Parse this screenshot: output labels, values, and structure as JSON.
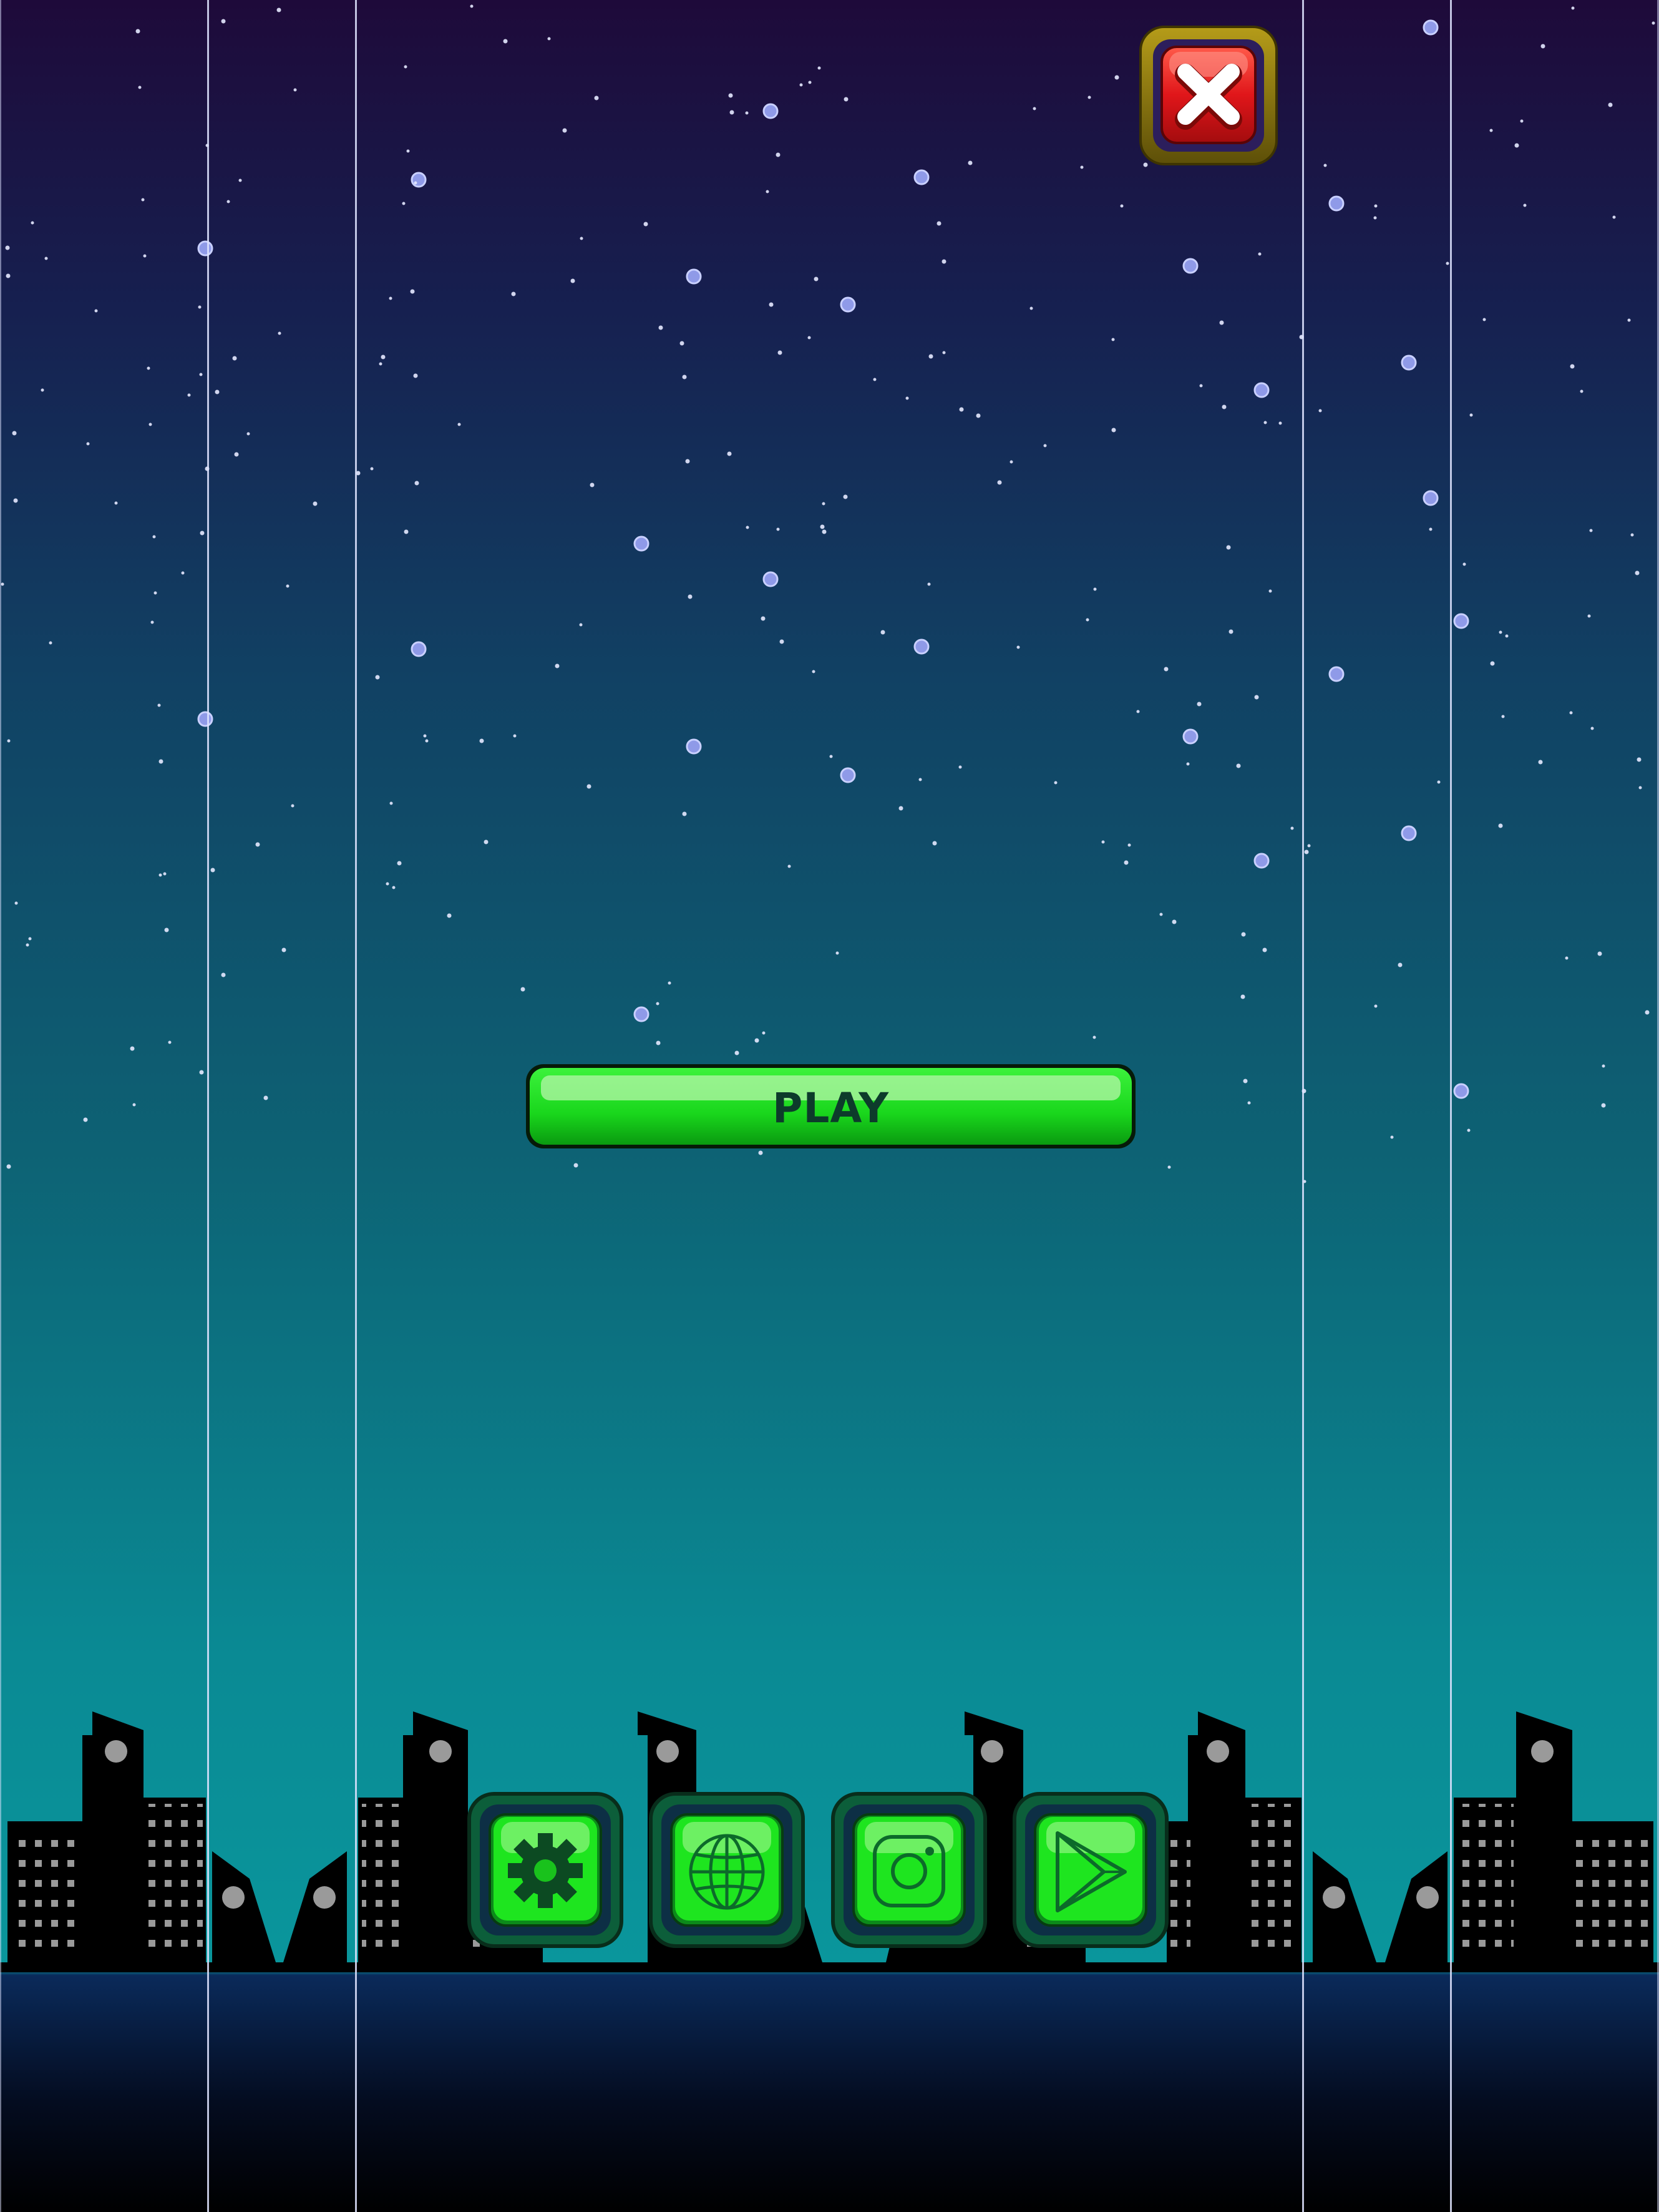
{
  "screen": {
    "name": "main-menu",
    "colors": {
      "sky_top": "#1e0a3a",
      "sky_bottom": "#0a969c",
      "button_green": "#19d61c",
      "button_label": "#0d3b2b",
      "close_red": "#e0161a",
      "close_frame": "#8a7a10",
      "skyline": "#000000",
      "stars": "#8f9ae8"
    }
  },
  "play_button": {
    "label": "PLAY",
    "icon": "play-bar-button"
  },
  "close_button": {
    "icon": "close-icon"
  },
  "bottom_menu": {
    "buttons": [
      {
        "id": "settings",
        "icon": "gear-icon"
      },
      {
        "id": "website",
        "icon": "globe-icon"
      },
      {
        "id": "instagram",
        "icon": "instagram-icon"
      },
      {
        "id": "google-play",
        "icon": "google-play-icon"
      }
    ]
  }
}
